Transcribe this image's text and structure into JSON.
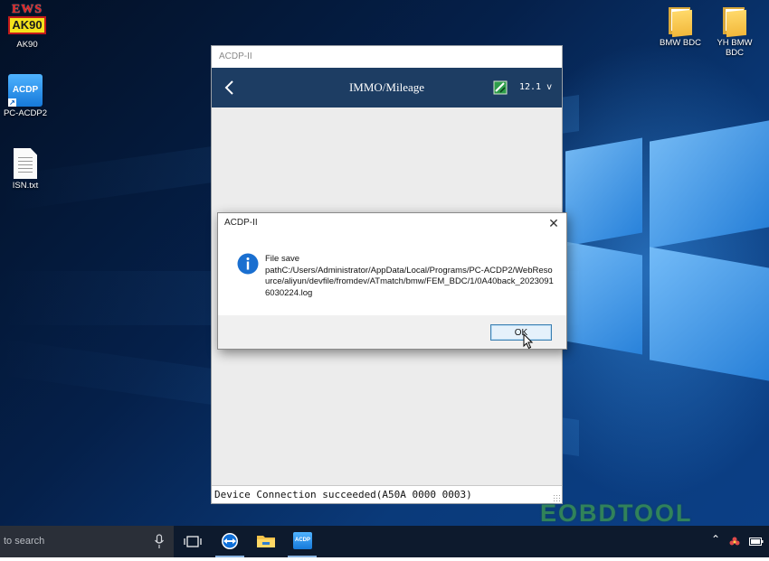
{
  "desktop": {
    "icons": [
      {
        "label": "AK90",
        "art_top": "EWS",
        "art_bottom": "AK90"
      },
      {
        "label": "PC-ACDP2",
        "art": "ACDP"
      },
      {
        "label": "ISN.txt"
      },
      {
        "label": "BMW BDC"
      },
      {
        "label": "YH BMW BDC"
      }
    ]
  },
  "app_window": {
    "title": "ACDP-II",
    "header_title": "IMMO/Mileage",
    "voltage": "12.1 v",
    "status": "Device Connection succeeded(A50A 0000 0003)"
  },
  "dialog": {
    "title": "ACDP-II",
    "message_line1": "File save",
    "message_path": "pathC:/Users/Administrator/AppData/Local/Programs/PC-ACDP2/WebResource/aliyun/devfile/fromdev/ATmatch/bmw/FEM_BDC/1/0A40back_20230916030224.log",
    "ok_label": "OK",
    "close_label": "✕"
  },
  "taskbar": {
    "search_placeholder": "to search",
    "pinned_apps": [
      "task-view",
      "teamviewer",
      "file-explorer",
      "pc-acdp2"
    ],
    "acdp_label": "ACDP"
  },
  "watermark": "EOBDTOOL",
  "colors": {
    "app_header": "#1d3d63",
    "info_icon": "#1a6fd0",
    "ok_button_border": "#3c7fb1",
    "taskbar": "#0d1a2d"
  }
}
